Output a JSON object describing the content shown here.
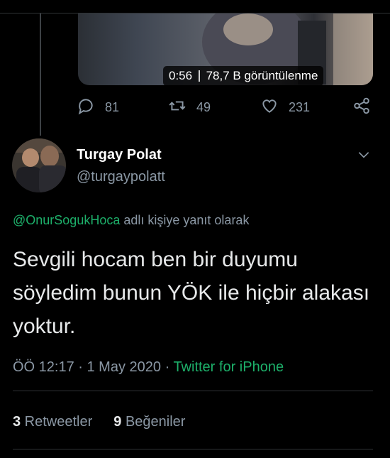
{
  "video": {
    "duration": "0:56",
    "views": "78,7 B görüntülenme"
  },
  "actions": {
    "replies": "81",
    "retweets": "49",
    "likes": "231"
  },
  "author": {
    "name": "Turgay Polat",
    "handle": "@turgaypolatt"
  },
  "reply": {
    "mention": "@OnurSogukHoca",
    "suffix": " adlı kişiye yanıt olarak"
  },
  "tweet": {
    "text": "Sevgili hocam ben bir duyumu söyledim bunun YÖK ile hiçbir alakası yoktur."
  },
  "meta": {
    "time": "ÖÖ 12:17",
    "date": "1 May 2020",
    "source": "Twitter for iPhone",
    "separator": " · "
  },
  "stats": {
    "retweets_count": "3",
    "retweets_label": " Retweetler",
    "likes_count": "9",
    "likes_label": " Beğeniler"
  },
  "icons": {
    "reply": "reply-icon",
    "retweet": "retweet-icon",
    "like": "heart-icon",
    "share": "share-icon",
    "more": "chevron-down-icon"
  },
  "colors": {
    "background": "#000000",
    "accent": "#1db06a",
    "secondary_text": "#8b98a5",
    "primary_text": "#e7e9ea"
  }
}
